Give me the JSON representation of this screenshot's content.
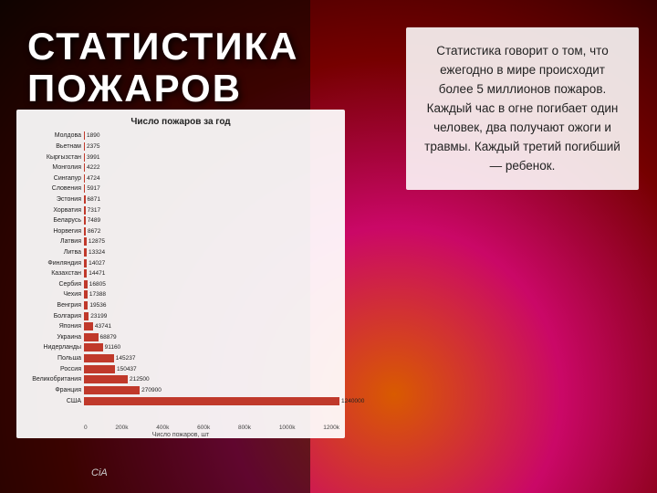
{
  "background": {
    "colors": [
      "#ff6a00",
      "#ee0979",
      "#8b0000",
      "#1a0000"
    ]
  },
  "title": {
    "line1": "СТАТИСТИКА",
    "line2": "ПОЖАРОВ"
  },
  "chart": {
    "title": "Число пожаров за год",
    "x_axis_label": "Число пожаров, шт",
    "x_ticks": [
      "0",
      "200000",
      "400000",
      "600000",
      "800000",
      "1000000",
      "1200000"
    ],
    "max_value": 270900,
    "bars": [
      {
        "country": "Молдова",
        "value": 1890
      },
      {
        "country": "Вьетнам",
        "value": 2375
      },
      {
        "country": "Кыргызстан",
        "value": 3991
      },
      {
        "country": "Монголия",
        "value": 4222
      },
      {
        "country": "Сингапур",
        "value": 4724
      },
      {
        "country": "Словения",
        "value": 5917
      },
      {
        "country": "Эстония",
        "value": 6871
      },
      {
        "country": "Хорватия",
        "value": 7317
      },
      {
        "country": "Беларусь",
        "value": 7489
      },
      {
        "country": "Норвегия",
        "value": 8672
      },
      {
        "country": "Латвия",
        "value": 12875
      },
      {
        "country": "Литва",
        "value": 13324
      },
      {
        "country": "Финляндия",
        "value": 14027
      },
      {
        "country": "Казахстан",
        "value": 14471
      },
      {
        "country": "Сербия",
        "value": 16805
      },
      {
        "country": "Чехия",
        "value": 17388
      },
      {
        "country": "Венгрия",
        "value": 19536
      },
      {
        "country": "Болгария",
        "value": 23199
      },
      {
        "country": "Япония",
        "value": 43741
      },
      {
        "country": "Украина",
        "value": 68879
      },
      {
        "country": "Нидерланды",
        "value": 91160
      },
      {
        "country": "Польша",
        "value": 145237
      },
      {
        "country": "Россия",
        "value": 150437
      },
      {
        "country": "Великобритания",
        "value": 212500
      },
      {
        "country": "Франция",
        "value": 270900
      },
      {
        "country": "США",
        "value": 1240000
      }
    ]
  },
  "text_box": {
    "content": "Статистика говорит о том, что ежегодно в мире происходит более 5 миллионов пожаров. Каждый час в огне погибает один человек, два получают ожоги и травмы. Каждый третий погибший — ребенок."
  },
  "cia_badge": {
    "text": "CiA"
  }
}
